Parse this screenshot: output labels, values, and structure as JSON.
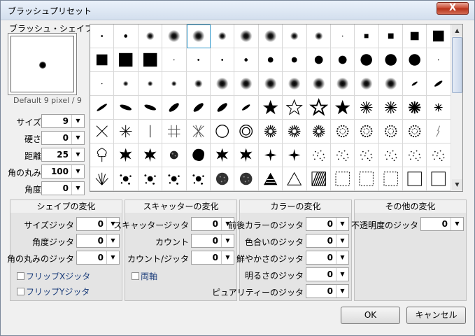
{
  "window": {
    "title": "ブラッシュプリセット",
    "close_label": "X"
  },
  "shape": {
    "section_label": "ブラッシュ・シェイプ",
    "preview_caption": "Default 9 pixel / 9",
    "params": [
      {
        "label": "サイズ",
        "value": "9"
      },
      {
        "label": "硬さ",
        "value": "0"
      },
      {
        "label": "距離",
        "value": "25"
      },
      {
        "label": "角の丸み",
        "value": "100"
      },
      {
        "label": "角度",
        "value": "0"
      }
    ]
  },
  "presets": {
    "cells": [
      "dot-xs",
      "dot-s",
      "soft-m",
      "soft-l",
      "soft-l",
      "soft-m",
      "soft-l",
      "soft-l",
      "soft-m",
      "soft-m",
      "dot-xxs",
      "sq-xs",
      "sq-s",
      "sq-m",
      "sq-l",
      "sq-l",
      "sq-xl",
      "sq-xl",
      "dot-xxs",
      "dot-xs",
      "dot-xs",
      "dot-s",
      "dot-m",
      "dot-m",
      "dot-l",
      "dot-l",
      "dot-xl",
      "dot-xl",
      "dot-xl",
      "dot-xxs",
      "dot-xxs",
      "soft-s",
      "soft-s",
      "soft-s",
      "soft-m",
      "soft-l",
      "soft-l",
      "soft-l",
      "soft-l",
      "soft-l",
      "soft-l",
      "soft-l",
      "soft-l",
      "streak-s",
      "ellipse-s",
      "ellipse-m",
      "ellipse-h",
      "ellipse-h",
      "ellipse-d",
      "ellipse-d",
      "ellipse-d",
      "ellipse-s",
      "star-fill",
      "star-outline",
      "star-outline2",
      "star-fill",
      "burst",
      "burst",
      "burst-b",
      "burst-s",
      "cross",
      "asterisk",
      "line-v",
      "hash",
      "hash2",
      "circle-outline",
      "circle-double",
      "sunburst",
      "sunburst",
      "sunburst",
      "dotring",
      "dotring",
      "dotring",
      "dotring",
      "scratch",
      "tree",
      "leaf",
      "leaf",
      "spatter-d",
      "blob",
      "leaf",
      "leaf",
      "spark",
      "spark",
      "scatter",
      "scatter",
      "scatter",
      "scatter",
      "scatter",
      "scatter",
      "grass",
      "splat",
      "splat",
      "splat",
      "splat",
      "sponge",
      "sponge",
      "triangle-fill",
      "triangle-outline",
      "hatch",
      "frame-dash",
      "frame-dash",
      "frame-dash",
      "frame",
      "frame",
      "frame"
    ],
    "selected_index": 4
  },
  "groups": {
    "shape_variation": {
      "title": "シェイプの変化",
      "rows": [
        {
          "label": "サイズジッタ",
          "value": "0"
        },
        {
          "label": "角度ジッタ",
          "value": "0"
        },
        {
          "label": "角の丸みのジッタ",
          "value": "0"
        }
      ],
      "checks": [
        "フリップXジッタ",
        "フリップYジッタ"
      ]
    },
    "scatter_variation": {
      "title": "スキャッターの変化",
      "rows": [
        {
          "label": "スキャッタージッタ",
          "value": "0"
        },
        {
          "label": "カウント",
          "value": "0"
        },
        {
          "label": "カウント/ジッタ",
          "value": "0"
        }
      ],
      "checks": [
        "両軸"
      ]
    },
    "color_variation": {
      "title": "カラーの変化",
      "rows": [
        {
          "label": "前後カラーのジッタ",
          "value": "0"
        },
        {
          "label": "色合いのジッタ",
          "value": "0"
        },
        {
          "label": "鮮やかさのジッタ",
          "value": "0"
        },
        {
          "label": "明るさのジッタ",
          "value": "0"
        },
        {
          "label": "ピュアリティーのジッタ",
          "value": "0"
        }
      ]
    },
    "other_variation": {
      "title": "その他の変化",
      "rows": [
        {
          "label": "不透明度のジッタ",
          "value": "0"
        }
      ]
    }
  },
  "buttons": {
    "ok": "OK",
    "cancel": "キャンセル"
  }
}
